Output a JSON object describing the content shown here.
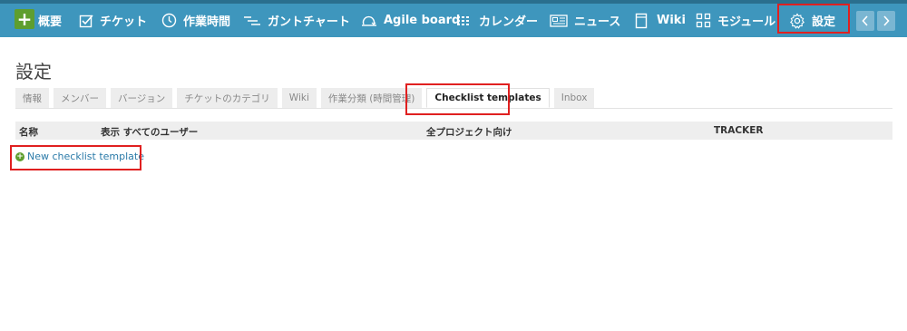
{
  "nav": {
    "overview": "概要",
    "tickets": "チケット",
    "time": "作業時間",
    "gantt": "ガントチャート",
    "agile": "Agile board",
    "calendar": "カレンダー",
    "news": "ニュース",
    "wiki": "Wiki",
    "modules": "モジュール",
    "settings": "設定"
  },
  "page": {
    "title": "設定"
  },
  "tabs": [
    {
      "label": "情報"
    },
    {
      "label": "メンバー"
    },
    {
      "label": "バージョン"
    },
    {
      "label": "チケットのカテゴリ"
    },
    {
      "label": "Wiki"
    },
    {
      "label": "作業分類 (時間管理)"
    },
    {
      "label": "Checklist templates"
    },
    {
      "label": "Inbox"
    }
  ],
  "table": {
    "headers": [
      "名称",
      "表示 すべてのユーザー",
      "全プロジェクト向け",
      "TRACKER"
    ]
  },
  "actions": {
    "new_template": "New checklist template"
  },
  "colors": {
    "nav_bg": "#3e96bd",
    "accent_green": "#5e9e2f",
    "link": "#2a7aa8",
    "highlight": "#e02020"
  }
}
